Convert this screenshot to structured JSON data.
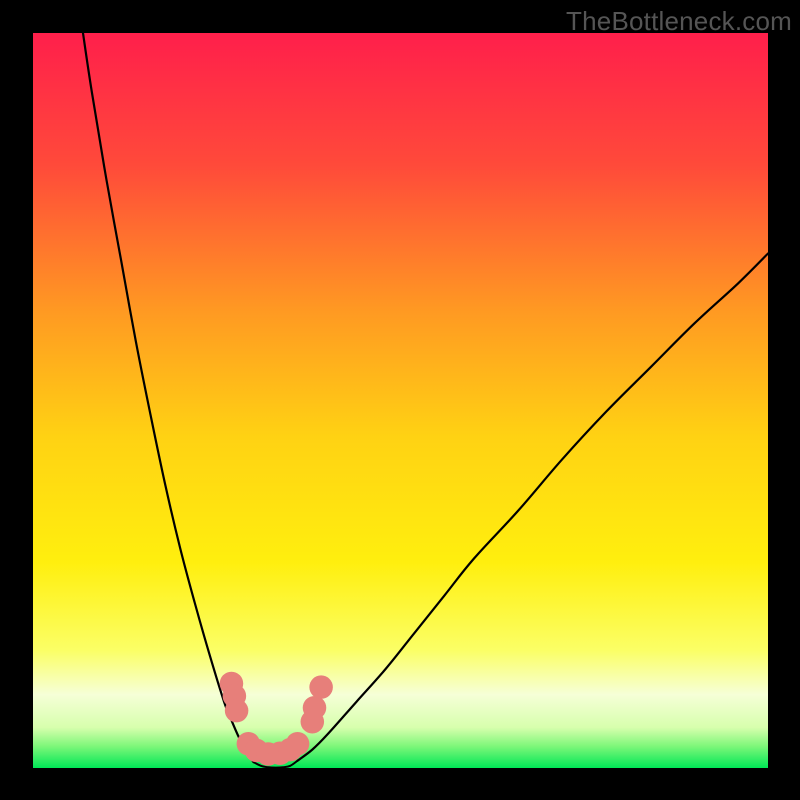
{
  "watermark": "TheBottleneck.com",
  "chart_data": {
    "type": "line",
    "title": "",
    "xlabel": "",
    "ylabel": "",
    "xlim": [
      0,
      100
    ],
    "ylim": [
      0,
      100
    ],
    "grid": false,
    "legend": false,
    "series": [
      {
        "name": "left-curve",
        "x": [
          6.8,
          8,
          10,
          12,
          14,
          16,
          18,
          20,
          22,
          24,
          26,
          27,
          28,
          29,
          30
        ],
        "y": [
          100,
          92,
          80,
          69,
          58,
          48,
          38.5,
          30,
          22.5,
          15.5,
          9,
          6.5,
          4.2,
          2.3,
          0.8
        ]
      },
      {
        "name": "right-curve",
        "x": [
          36,
          38,
          40,
          44,
          48,
          52,
          56,
          60,
          66,
          72,
          78,
          84,
          90,
          96,
          100
        ],
        "y": [
          1.0,
          2.5,
          4.5,
          9,
          13.5,
          18.5,
          23.5,
          28.5,
          35,
          42,
          48.5,
          54.5,
          60.5,
          66,
          70
        ]
      },
      {
        "name": "valley-floor",
        "x": [
          30,
          31,
          32,
          33,
          34,
          35,
          36
        ],
        "y": [
          0.8,
          0.3,
          0.1,
          0.05,
          0.1,
          0.3,
          1.0
        ]
      }
    ],
    "markers": [
      {
        "name": "left-marker-1",
        "x": 27.0,
        "y": 11.5,
        "r": 1.6
      },
      {
        "name": "left-marker-2",
        "x": 27.4,
        "y": 9.8,
        "r": 1.6
      },
      {
        "name": "left-marker-3",
        "x": 27.7,
        "y": 7.8,
        "r": 1.6
      },
      {
        "name": "valley-marker-1",
        "x": 29.3,
        "y": 3.3,
        "r": 1.6
      },
      {
        "name": "valley-marker-2",
        "x": 30.4,
        "y": 2.4,
        "r": 1.6
      },
      {
        "name": "valley-marker-3",
        "x": 32.0,
        "y": 1.9,
        "r": 1.6
      },
      {
        "name": "valley-marker-4",
        "x": 33.6,
        "y": 2.0,
        "r": 1.6
      },
      {
        "name": "valley-marker-5",
        "x": 35.0,
        "y": 2.5,
        "r": 1.6
      },
      {
        "name": "right-marker-1",
        "x": 36.0,
        "y": 3.3,
        "r": 1.6
      },
      {
        "name": "right-marker-2",
        "x": 38.0,
        "y": 6.3,
        "r": 1.6
      },
      {
        "name": "right-marker-3",
        "x": 38.3,
        "y": 8.2,
        "r": 1.6
      },
      {
        "name": "right-marker-4",
        "x": 39.2,
        "y": 11.0,
        "r": 1.6
      }
    ],
    "colors": {
      "curve": "#000000",
      "marker": "#e77f7a",
      "green_band": "#00e756",
      "background_top": "#ff1f4b",
      "background_mid": "#ffe108",
      "background_low": "#f9ffb3"
    }
  }
}
